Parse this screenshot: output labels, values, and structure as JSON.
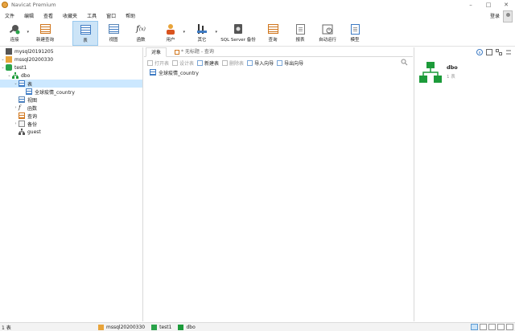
{
  "window": {
    "title": "Navicat Premium"
  },
  "menu": {
    "items": [
      "文件",
      "编辑",
      "查看",
      "收藏夹",
      "工具",
      "窗口",
      "帮助"
    ],
    "login": "登录"
  },
  "toolbar": {
    "connect": "连接",
    "new_query": "新建查询",
    "table": "表",
    "view": "视图",
    "function": "函数",
    "user": "用户",
    "other": "其它",
    "sqlserver_backup": "SQL Server 备份",
    "query": "查询",
    "report": "报表",
    "automation": "自动运行",
    "model": "模型"
  },
  "tree": {
    "conn1": "mysql20191205",
    "conn2": "mssql20200330",
    "db": "test1",
    "schema": "dbo",
    "tables": "表",
    "table1": "全球疫情_country",
    "views": "视图",
    "functions": "函数",
    "queries": "查询",
    "backups": "备份",
    "user": "guest"
  },
  "tabs": {
    "objects": "对象",
    "untitled_query": "* 无标题 - 查询"
  },
  "objbar": {
    "open_table": "打开表",
    "design_table": "设计表",
    "new_table": "新建表",
    "delete_table": "删除表",
    "import_wizard": "导入向导",
    "export_wizard": "导出向导"
  },
  "objects": [
    "全球疫情_country"
  ],
  "info_panel": {
    "name": "dbo",
    "count": "1 表"
  },
  "status": {
    "left": "1 表",
    "connection": "mssql20200330",
    "database": "test1",
    "schema": "dbo"
  },
  "colors": {
    "accent": "#cce4f7",
    "accent_border": "#99c9ef",
    "schema_green": "#1c9b3a",
    "table_blue": "#3e7bc4"
  }
}
